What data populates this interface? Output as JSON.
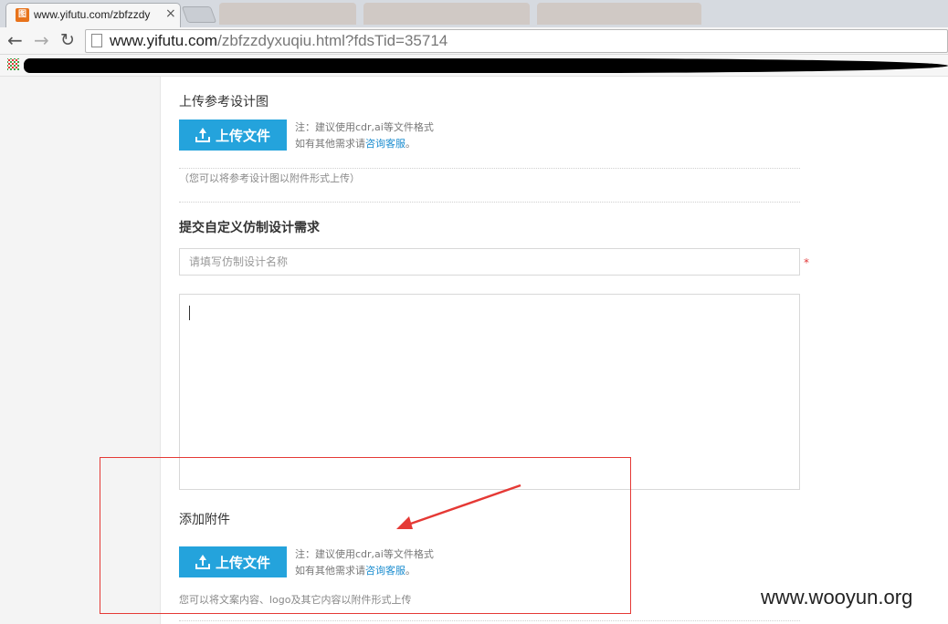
{
  "browser": {
    "tab_title": "www.yifutu.com/zbfzzdy",
    "favicon_glyph": "图",
    "url_host": "www.yifutu.com",
    "url_path": "/zbfzzdyxuqiu.html?fdsTid=35714"
  },
  "reference_section": {
    "title": "上传参考设计图",
    "upload_label": "上传文件",
    "note_line1": "注：建议使用cdr,ai等文件格式",
    "note_line2_prefix": "如有其他需求请",
    "note_link": "咨询客服",
    "note_line2_suffix": "。",
    "hint": "（您可以将参考设计图以附件形式上传）"
  },
  "custom_section": {
    "title": "提交自定义仿制设计需求",
    "name_placeholder": "请填写仿制设计名称",
    "required_mark": "*"
  },
  "attachment_section": {
    "title": "添加附件",
    "upload_label": "上传文件",
    "note_line1": "注：建议使用cdr,ai等文件格式",
    "note_line2_prefix": "如有其他需求请",
    "note_link": "咨询客服",
    "note_line2_suffix": "。",
    "hint": "您可以将文案内容、logo及其它内容以附件形式上传"
  },
  "watermark": "www.wooyun.org",
  "colors": {
    "upload_button": "#24a3dc",
    "link": "#1a8ccf",
    "annotation_red": "#e53935"
  }
}
